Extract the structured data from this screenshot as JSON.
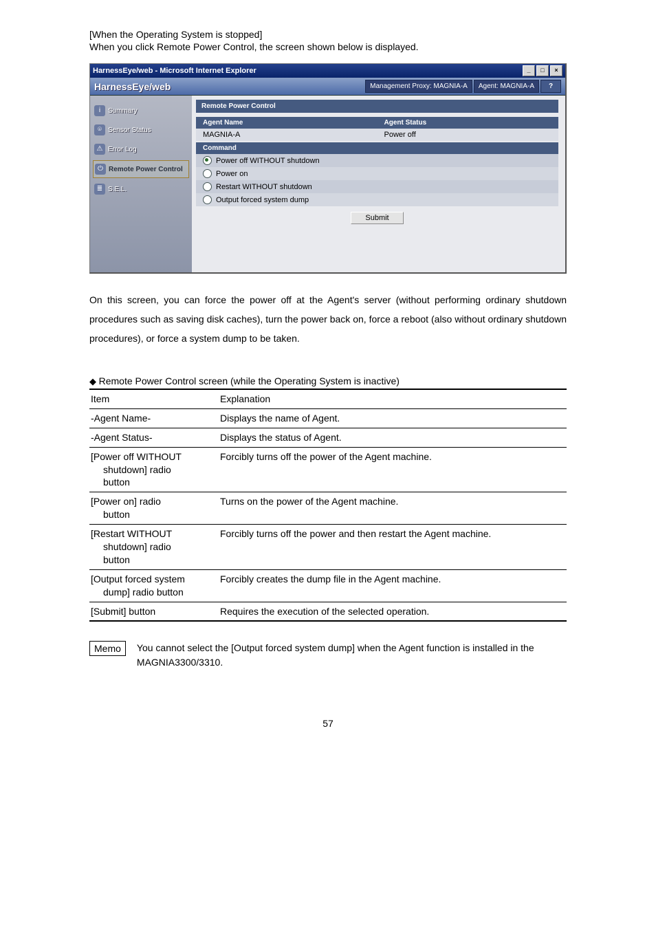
{
  "intro": {
    "line1": "[When the Operating System is stopped]",
    "line2": "When you click Remote Power Control, the screen shown below is displayed."
  },
  "window": {
    "title": "HarnessEye/web - Microsoft Internet Explorer",
    "brand": "HarnessEye/web",
    "mgmt_proxy": "Management Proxy: MAGNIA-A",
    "agent": "Agent: MAGNIA-A",
    "help": "?"
  },
  "sidebar": {
    "items": [
      {
        "label": "Summary"
      },
      {
        "label": "Sensor Status"
      },
      {
        "label": "Error Log"
      },
      {
        "label": "Remote Power Control"
      },
      {
        "label": "S.E.L."
      }
    ]
  },
  "panel": {
    "title": "Remote Power Control",
    "col1": "Agent Name",
    "col2": "Agent Status",
    "row_name": "MAGNIA-A",
    "row_status": "Power off",
    "cmd_header": "Command",
    "opts": [
      "Power off WITHOUT shutdown",
      "Power on",
      "Restart WITHOUT shutdown",
      "Output forced system dump"
    ],
    "submit": "Submit"
  },
  "paragraph": "On this screen, you can force the power off at the Agent's server (without performing ordinary shutdown procedures such as saving disk caches), turn the power back on, force a reboot (also without ordinary shutdown procedures), or force a system dump to be taken.",
  "legend": {
    "title": "Remote Power Control screen (while the Operating System is inactive)",
    "h1": "Item",
    "h2": "Explanation",
    "rows": [
      {
        "i": "-Agent Name-",
        "e": "Displays the name of Agent."
      },
      {
        "i": "-Agent Status-",
        "e": "Displays the status of Agent."
      },
      {
        "i": "[Power off WITHOUT",
        "i2": "shutdown] radio",
        "i3": "button",
        "e": "Forcibly turns off the power of the Agent machine."
      },
      {
        "i": "[Power on] radio",
        "i2": "button",
        "e": "Turns on the power of the Agent machine."
      },
      {
        "i": "[Restart WITHOUT",
        "i2": "shutdown] radio",
        "i3": "button",
        "e": "Forcibly turns off the power and then restart the Agent machine."
      },
      {
        "i": "[Output forced system",
        "i2": "dump] radio button",
        "e": "Forcibly creates the dump file in the Agent machine."
      },
      {
        "i": "[Submit] button",
        "e": "Requires the execution of the selected operation."
      }
    ]
  },
  "memo": {
    "label": "Memo",
    "text": "You cannot select the [Output forced system dump] when the Agent function is installed in the MAGNIA3300/3310."
  },
  "pagenum": "57"
}
